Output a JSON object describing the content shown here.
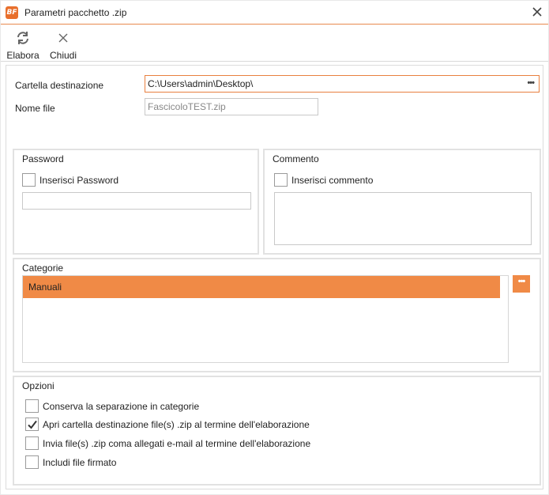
{
  "window": {
    "icon_text": "BF",
    "title": "Parametri pacchetto .zip"
  },
  "toolbar": {
    "process_label": "Elabora",
    "close_label": "Chiudi"
  },
  "form": {
    "dest_folder_label": "Cartella destinazione",
    "dest_folder_value": "C:\\Users\\admin\\Desktop\\",
    "browse_label": "•••",
    "file_name_label": "Nome file",
    "file_name_placeholder": "FascicoloTEST.zip"
  },
  "password": {
    "title": "Password",
    "checkbox_label": "Inserisci Password",
    "checked": false,
    "value": ""
  },
  "comment": {
    "title": "Commento",
    "checkbox_label": "Inserisci commento",
    "checked": false,
    "value": ""
  },
  "categories": {
    "title": "Categorie",
    "items": [
      "Manuali"
    ],
    "selected_index": 0,
    "add_label": "•••"
  },
  "options": {
    "title": "Opzioni",
    "items": [
      {
        "label": "Conserva la separazione in categorie",
        "checked": false
      },
      {
        "label": "Apri cartella destinazione file(s) .zip al termine dell'elaborazione",
        "checked": true
      },
      {
        "label": "Invia file(s) .zip coma allegati e-mail al termine dell'elaborazione",
        "checked": false
      },
      {
        "label": "Includi file firmato",
        "checked": false
      }
    ]
  },
  "colors": {
    "accent": "#f08a46",
    "title_border": "#e88a4e",
    "app_icon": "#e86f2c"
  },
  "icons": {
    "app": "app-logo-icon",
    "close": "close-icon",
    "process": "refresh-icon",
    "toolbar_close": "close-icon"
  }
}
